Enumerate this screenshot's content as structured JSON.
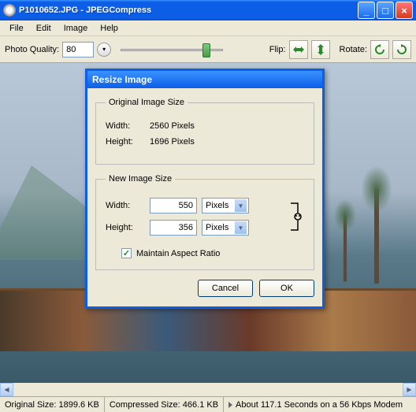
{
  "window": {
    "title": "P1010652.JPG - JPEGCompress"
  },
  "menu": {
    "file": "File",
    "edit": "Edit",
    "image": "Image",
    "help": "Help"
  },
  "toolbar": {
    "quality_label": "Photo Quality:",
    "quality_value": "80",
    "flip_label": "Flip:",
    "rotate_label": "Rotate:"
  },
  "dialog": {
    "title": "Resize Image",
    "original": {
      "legend": "Original Image Size",
      "width_label": "Width:",
      "width_value": "2560 Pixels",
      "height_label": "Height:",
      "height_value": "1696 Pixels"
    },
    "new": {
      "legend": "New Image Size",
      "width_label": "Width:",
      "width_value": "550",
      "width_unit": "Pixels",
      "height_label": "Height:",
      "height_value": "356",
      "height_unit": "Pixels",
      "aspect_label": "Maintain Aspect Ratio",
      "aspect_checked": true
    },
    "cancel": "Cancel",
    "ok": "OK"
  },
  "status": {
    "original": "Original Size: 1899.6 KB",
    "compressed": "Compressed Size: 466.1 KB",
    "modem": "About 117.1 Seconds on a 56 Kbps Modem"
  }
}
